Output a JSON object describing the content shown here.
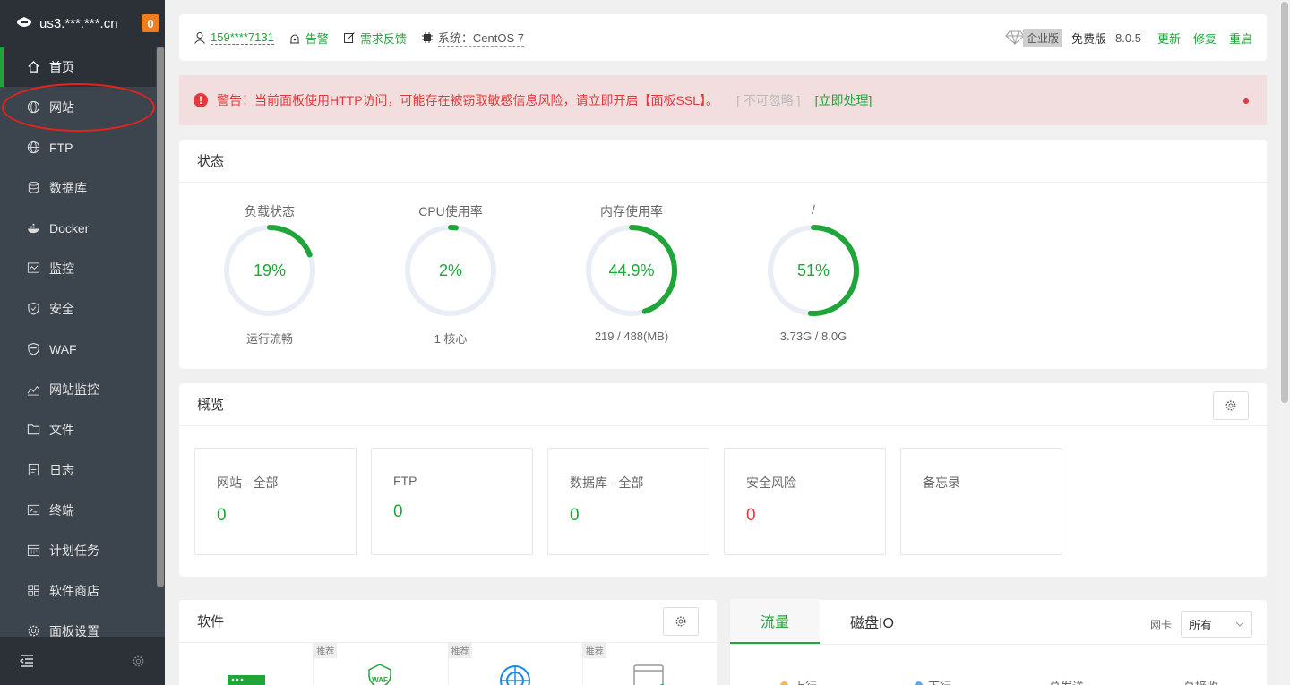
{
  "sidebar": {
    "host": "us3.***.***.cn",
    "badge": "0",
    "items": [
      {
        "label": "首页",
        "icon": "home-icon"
      },
      {
        "label": "网站",
        "icon": "globe-icon"
      },
      {
        "label": "FTP",
        "icon": "globe-icon"
      },
      {
        "label": "数据库",
        "icon": "database-icon"
      },
      {
        "label": "Docker",
        "icon": "docker-icon"
      },
      {
        "label": "监控",
        "icon": "monitor-icon"
      },
      {
        "label": "安全",
        "icon": "shield-icon"
      },
      {
        "label": "WAF",
        "icon": "waf-icon"
      },
      {
        "label": "网站监控",
        "icon": "chart-line-icon"
      },
      {
        "label": "文件",
        "icon": "folder-icon"
      },
      {
        "label": "日志",
        "icon": "log-icon"
      },
      {
        "label": "终端",
        "icon": "terminal-icon"
      },
      {
        "label": "计划任务",
        "icon": "calendar-icon"
      },
      {
        "label": "软件商店",
        "icon": "grid-icon"
      },
      {
        "label": "面板设置",
        "icon": "gear-icon"
      }
    ]
  },
  "topbar": {
    "user": "159****7131",
    "alarm": "告警",
    "feedback": "需求反馈",
    "system": "系统：CentOS 7",
    "edition": "企业版",
    "plan": "免费版",
    "version": "8.0.5",
    "update": "更新",
    "repair": "修复",
    "restart": "重启"
  },
  "alert": {
    "message": "警告！当前面板使用HTTP访问，可能存在被窃取敏感信息风险，请立即开启【面板SSL】。",
    "ignore": "[ 不可忽略 ]",
    "action": "[立即处理]"
  },
  "status": {
    "title": "状态",
    "gauges": [
      {
        "title": "负载状态",
        "value": "19%",
        "percent": 19,
        "sub": "运行流畅"
      },
      {
        "title": "CPU使用率",
        "value": "2%",
        "percent": 2,
        "sub": "1 核心"
      },
      {
        "title": "内存使用率",
        "value": "44.9%",
        "percent": 44.9,
        "sub": "219 / 488(MB)"
      },
      {
        "title": "/",
        "value": "51%",
        "percent": 51,
        "sub": "3.73G / 8.0G"
      }
    ]
  },
  "overview": {
    "title": "概览",
    "boxes": [
      {
        "label": "网站 - 全部",
        "value": "0"
      },
      {
        "label": "FTP",
        "value": "0"
      },
      {
        "label": "数据库 - 全部",
        "value": "0"
      },
      {
        "label": "安全风险",
        "value": "0"
      },
      {
        "label": "备忘录",
        "value": ""
      }
    ]
  },
  "software": {
    "title": "软件",
    "tag": "推荐"
  },
  "traffic": {
    "tab_flow": "流量",
    "tab_disk": "磁盘IO",
    "nic_label": "网卡",
    "nic_value": "所有",
    "legend": [
      "上行",
      "下行",
      "总发送",
      "总接收"
    ]
  },
  "colors": {
    "accent": "#20a53a",
    "danger": "#e4393c",
    "sidebar": "#3c444d"
  }
}
